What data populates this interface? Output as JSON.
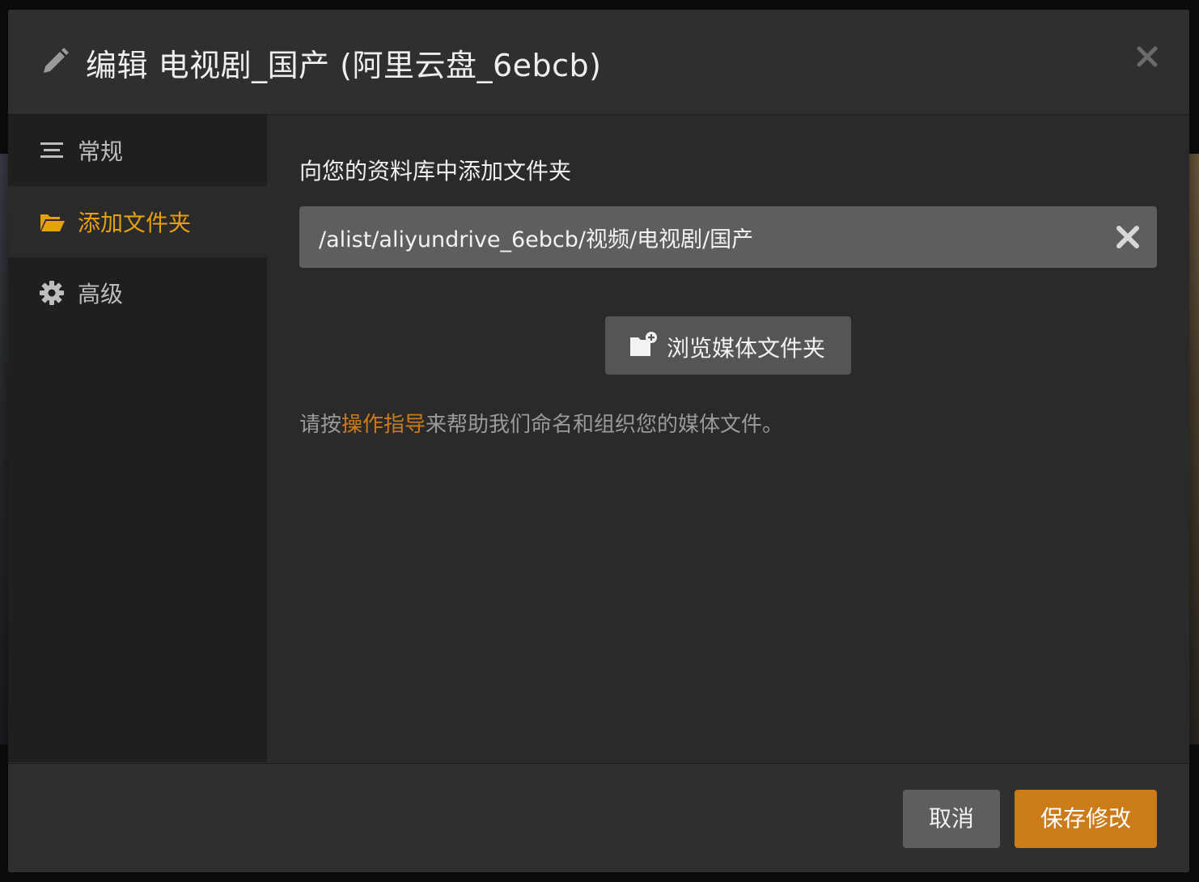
{
  "modal": {
    "title": "编辑 电视剧_国产 (阿里云盘_6ebcb)",
    "header_icon": "pencil-icon",
    "close_icon": "close-icon"
  },
  "sidebar": {
    "items": [
      {
        "label": "常规",
        "icon": "list-icon",
        "active": false
      },
      {
        "label": "添加文件夹",
        "icon": "folder-open-icon",
        "active": true
      },
      {
        "label": "高级",
        "icon": "gear-icon",
        "active": false
      }
    ]
  },
  "content": {
    "section_label": "向您的资料库中添加文件夹",
    "folder_path": "/alist/aliyundrive_6ebcb/视频/电视剧/国产",
    "browse_label": "浏览媒体文件夹",
    "help_prefix": "请按",
    "help_link": "操作指导",
    "help_suffix": "来帮助我们命名和组织您的媒体文件。"
  },
  "footer": {
    "cancel_label": "取消",
    "save_label": "保存修改"
  },
  "colors": {
    "accent": "#e5a00d",
    "save_button": "#cc7b19",
    "link": "#cc7b19",
    "modal_bg": "#2a2a2a",
    "sidebar_bg": "#1f1f1f"
  }
}
